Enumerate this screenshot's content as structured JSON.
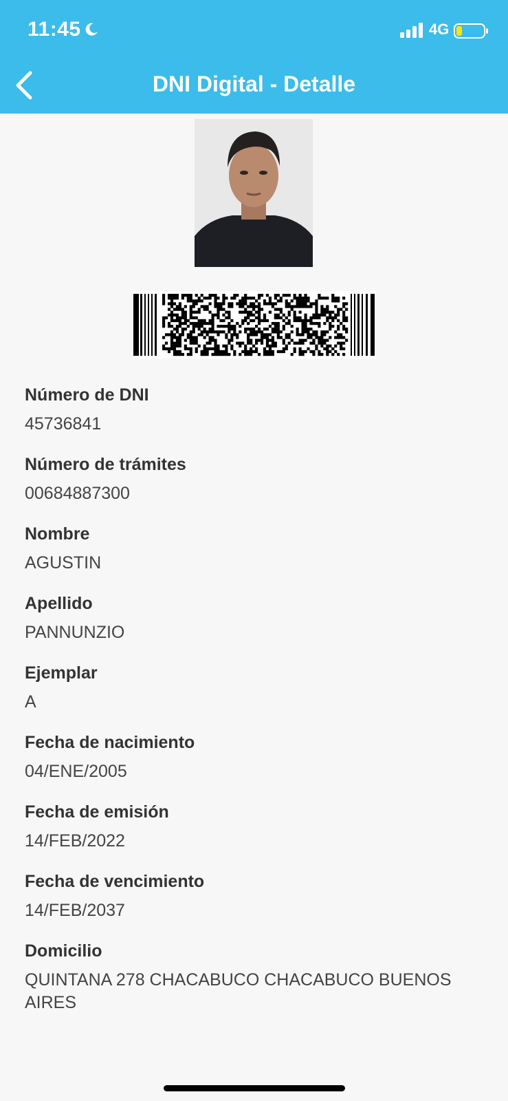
{
  "status_bar": {
    "time": "11:45",
    "network": "4G",
    "icons": [
      "moon-icon",
      "signal-icon",
      "battery-icon"
    ]
  },
  "header": {
    "title": "DNI Digital - Detalle",
    "back_icon": "chevron-left-icon",
    "color": "#3bbcea"
  },
  "fields": [
    {
      "label": "Número de DNI",
      "value": "45736841"
    },
    {
      "label": "Número de trámites",
      "value": "00684887300"
    },
    {
      "label": "Nombre",
      "value": "AGUSTIN"
    },
    {
      "label": "Apellido",
      "value": "PANNUNZIO"
    },
    {
      "label": "Ejemplar",
      "value": "A"
    },
    {
      "label": "Fecha de nacimiento",
      "value": "04/ENE/2005"
    },
    {
      "label": "Fecha de emisión",
      "value": "14/FEB/2022"
    },
    {
      "label": "Fecha de vencimiento",
      "value": "14/FEB/2037"
    },
    {
      "label": "Domicilio",
      "value": "QUINTANA 278 CHACABUCO CHACABUCO BUENOS AIRES"
    }
  ]
}
